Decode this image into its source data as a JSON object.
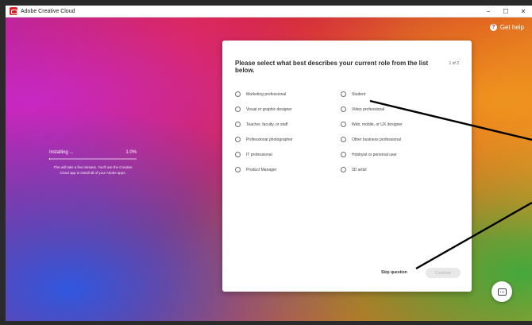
{
  "window": {
    "title": "Adobe Creative Cloud",
    "controls": {
      "minimize": "−",
      "maximize": "☐",
      "close": "✕"
    }
  },
  "header": {
    "get_help": "Get help",
    "help_icon": "?"
  },
  "install": {
    "label": "Installing ...",
    "percent": "1.0%",
    "progress": 0.01,
    "description": "This will take a few minutes. You'll use the Creative Cloud app to install all of your Adobe apps."
  },
  "dialog": {
    "title": "Please select what best describes your current role from the list below.",
    "page_count": "1 of 2",
    "options": [
      "Marketing professional",
      "Student",
      "Visual or graphic designer",
      "Video professional",
      "Teacher, faculty, or staff",
      "Web, mobile, or UX designer",
      "Professional photographer",
      "Other business professional",
      "IT professional",
      "Hobbyist or personal user",
      "Product Manager",
      "3D artist"
    ],
    "skip_label": "Skip question",
    "continue_label": "Continue"
  },
  "colors": {
    "brand_red": "#da1f26",
    "annotation": "#000000"
  }
}
